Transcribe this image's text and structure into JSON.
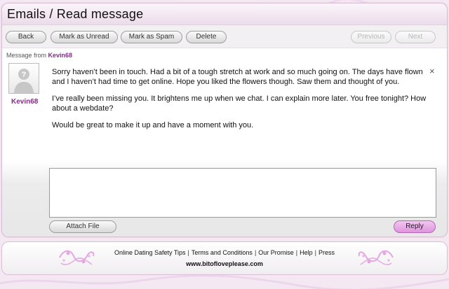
{
  "header": {
    "title": "Emails / Read message"
  },
  "toolbar": {
    "back": "Back",
    "mark_unread": "Mark as Unread",
    "mark_spam": "Mark as Spam",
    "delete": "Delete",
    "previous": "Previous",
    "next": "Next"
  },
  "message": {
    "from_label": "Message from",
    "sender": "Kevin68",
    "avatar_icon": "user-silhouette-icon",
    "close": "×",
    "paragraphs": [
      "Sorry haven’t been in touch. Had a bit of a tough stretch at work and so much going on. The days have flown and I haven’t had time to get online. Hope you liked the flowers though. Saw them and thought of you.",
      "I’ve really been missing you. It brightens me up when we chat. I can explain more later. You free tonight? How about a webdate?",
      "Would be great to make it up and have a moment with you."
    ]
  },
  "reply": {
    "value": "",
    "attach": "Attach File",
    "reply": "Reply"
  },
  "footer": {
    "links": [
      "Online Dating Safety Tips",
      "Terms and Conditions",
      "Our Promise",
      "Help",
      "Press"
    ],
    "url": "www.bitofloveplease.com"
  },
  "colors": {
    "accent": "#8a2a8e",
    "reply_button": "#e6a6e4",
    "background": "#f4e9f3"
  }
}
